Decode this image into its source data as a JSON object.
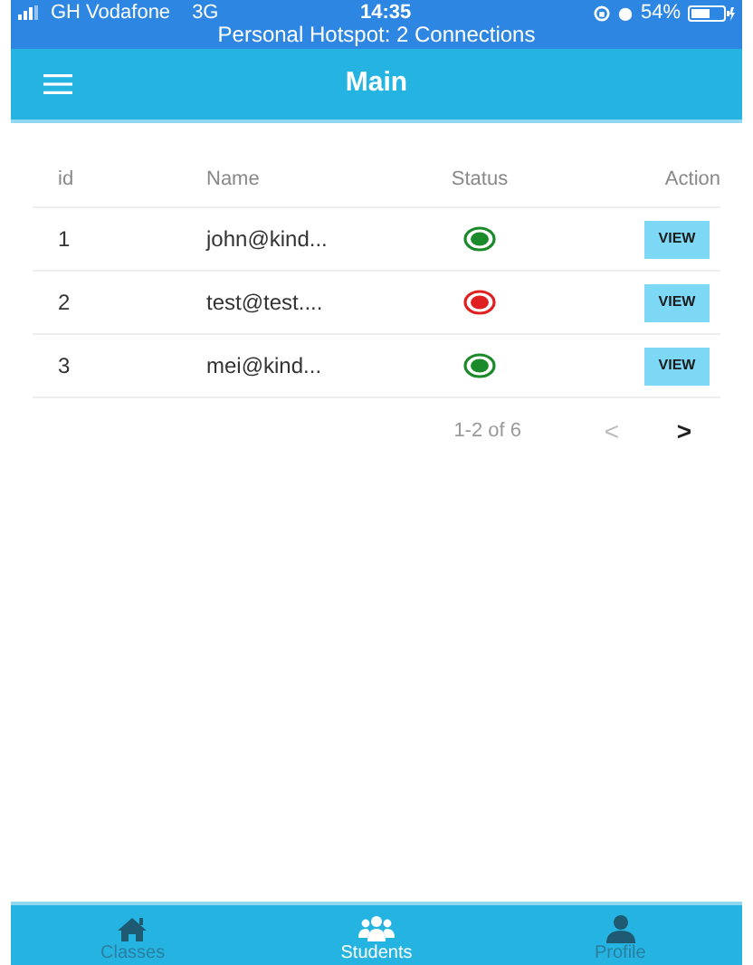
{
  "status_bar": {
    "carrier": "GH Vodafone",
    "network": "3G",
    "time": "14:35",
    "battery": "54%",
    "hotspot": "Personal Hotspot: 2 Connections"
  },
  "header": {
    "title": "Main"
  },
  "table": {
    "columns": [
      "id",
      "Name",
      "Status",
      "Action"
    ],
    "rows": [
      {
        "id": "1",
        "name": "john@kind...",
        "active": true,
        "action": "VIEW"
      },
      {
        "id": "2",
        "name": "test@test....",
        "active": false,
        "action": "VIEW"
      },
      {
        "id": "3",
        "name": "mei@kind...",
        "active": true,
        "action": "VIEW"
      }
    ]
  },
  "pagination": {
    "range": "1-2 of 6",
    "prev": {
      "label": "<",
      "disabled": true
    },
    "next": {
      "label": ">",
      "disabled": false
    }
  },
  "bottom_nav": [
    {
      "kind": "home",
      "label": "Classes",
      "selected": false
    },
    {
      "kind": "group",
      "label": "Students",
      "selected": true
    },
    {
      "kind": "person",
      "label": "Profile",
      "selected": false
    }
  ]
}
